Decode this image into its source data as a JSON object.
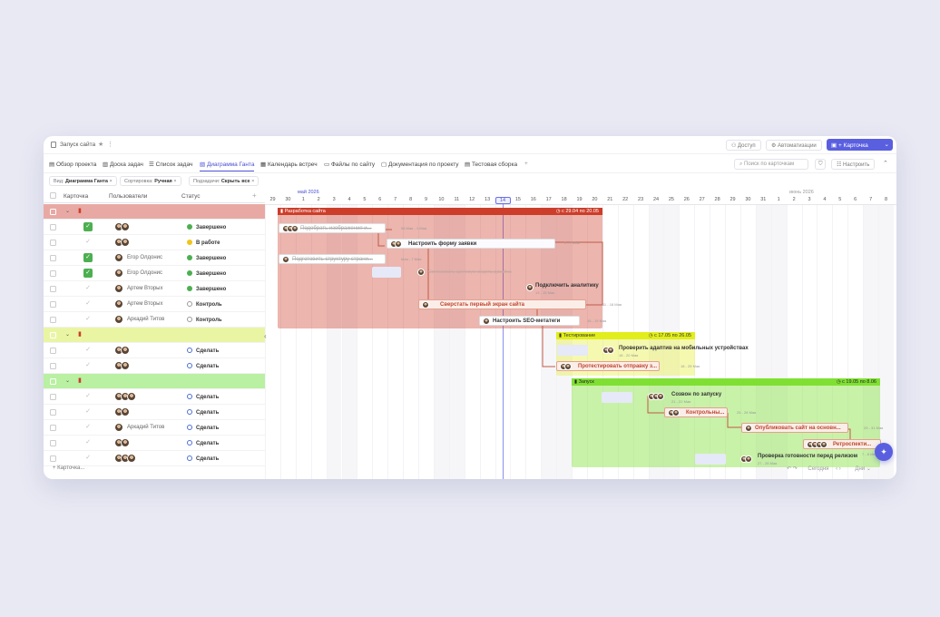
{
  "header": {
    "project_title": "Запуск сайта",
    "access_label": "Доступ",
    "automation_label": "Автоматизации",
    "card_button": "+ Карточка"
  },
  "tabs": [
    {
      "label": "Обзор проекта"
    },
    {
      "label": "Доска задач"
    },
    {
      "label": "Список задач"
    },
    {
      "label": "Диаграмма Ганта"
    },
    {
      "label": "Календарь встреч"
    },
    {
      "label": "Файлы по сайту"
    },
    {
      "label": "Документация по проекту"
    },
    {
      "label": "Тестовая сборка"
    }
  ],
  "search": {
    "placeholder": "Поиск по карточкам"
  },
  "configure_label": "Настроить",
  "filters": {
    "view_label": "Вид:",
    "view_value": "Диаграмма Ганта",
    "sort_label": "Сортировка:",
    "sort_value": "Ручная",
    "subtasks_label": "Подзадачи:",
    "subtasks_value": "Скрыть все"
  },
  "columns": {
    "card": "Карточка",
    "users": "Пользователи",
    "status": "Статус"
  },
  "rows": [
    {
      "type": "group",
      "color": "#e8a9a4"
    },
    {
      "checked": true,
      "user": "",
      "status": "Завершено",
      "kind": "done"
    },
    {
      "checked": false,
      "user": "",
      "status": "В работе",
      "kind": "work"
    },
    {
      "checked": true,
      "user": "Егор Олдонис",
      "status": "Завершено",
      "kind": "done"
    },
    {
      "checked": true,
      "user": "Егор Олдонис",
      "status": "Завершено",
      "kind": "done"
    },
    {
      "checked": false,
      "user": "Артем Вторых",
      "status": "Завершено",
      "kind": "done"
    },
    {
      "checked": false,
      "user": "Артем Вторых",
      "status": "Контроль",
      "kind": "ctrl"
    },
    {
      "checked": false,
      "user": "Аркадий Титов",
      "status": "Контроль",
      "kind": "ctrl"
    },
    {
      "type": "group",
      "color": "#eaf5a4"
    },
    {
      "checked": false,
      "user": "",
      "status": "Сделать",
      "kind": "todo"
    },
    {
      "checked": false,
      "user": "",
      "status": "Сделать",
      "kind": "todo"
    },
    {
      "type": "group",
      "color": "#b9f0a2"
    },
    {
      "checked": false,
      "user": "",
      "status": "Сделать",
      "kind": "todo"
    },
    {
      "checked": false,
      "user": "",
      "status": "Сделать",
      "kind": "todo"
    },
    {
      "checked": false,
      "user": "Аркадий Титов",
      "status": "Сделать",
      "kind": "todo"
    },
    {
      "checked": false,
      "user": "",
      "status": "Сделать",
      "kind": "todo"
    },
    {
      "checked": false,
      "user": "",
      "status": "Сделать",
      "kind": "todo"
    }
  ],
  "add_card": "+ Карточка...",
  "timeline": {
    "month_may": "май 2026",
    "month_june": "июнь 2026",
    "days": [
      "29",
      "30",
      "1",
      "2",
      "3",
      "4",
      "5",
      "6",
      "7",
      "8",
      "9",
      "10",
      "11",
      "12",
      "13",
      "14",
      "15",
      "16",
      "17",
      "18",
      "19",
      "20",
      "21",
      "22",
      "23",
      "24",
      "25",
      "26",
      "27",
      "28",
      "29",
      "30",
      "31",
      "1",
      "2",
      "3",
      "4",
      "5",
      "6",
      "7",
      "8"
    ],
    "today": "14"
  },
  "groups": [
    {
      "title": "Разработка сайта",
      "dates": "с 29.04 по 20.05",
      "color": "#cc3d2a"
    },
    {
      "title": "Тестирование",
      "dates": "с 17.05 по 26.05",
      "color": "#e1ee1c"
    },
    {
      "title": "Запуск",
      "dates": "с 19.05 по 8.06",
      "color": "#7fe033"
    }
  ],
  "tasks": [
    {
      "label": "Подобрать изображения и...",
      "sub": "06 Мая - 1 Мая"
    },
    {
      "label": "Настроить форму заявки",
      "sub": "2 - 7 Мая"
    },
    {
      "label": "Подготовить структуру страни...",
      "sub": "Мая - 7 Мая"
    },
    {
      "label": "Согласовать цветовую модель дизайна",
      "sub": ""
    },
    {
      "label": "Подключить аналитику",
      "sub": "13 - 15 Мая"
    },
    {
      "label": "Сверстать первый экран сайта",
      "sub": "11 - 18 Мая"
    },
    {
      "label": "Настроить SEO-метатеги",
      "sub": "15 - 19 Мая"
    },
    {
      "label": "Проверить адаптив на мобильных устройствах",
      "sub": "18 - 20 Мая"
    },
    {
      "label": "Протестировать отправку з...",
      "sub": "18 - 25 Мая"
    },
    {
      "label": "Созвон по запуску",
      "sub": "21 - 22 Мая"
    },
    {
      "label": "Контрольны...",
      "sub": "25 - 28 Мая"
    },
    {
      "label": "Опубликовать сайт на основн...",
      "sub": "29 - 31 Мая"
    },
    {
      "label": "Ретроспекти...",
      "sub": "7 - 8 Июня"
    },
    {
      "label": "Проверка готовности перед релизом",
      "sub": "27 - 28 Мая"
    }
  ],
  "footer": {
    "today": "Сегодня",
    "scale": "Дни"
  }
}
